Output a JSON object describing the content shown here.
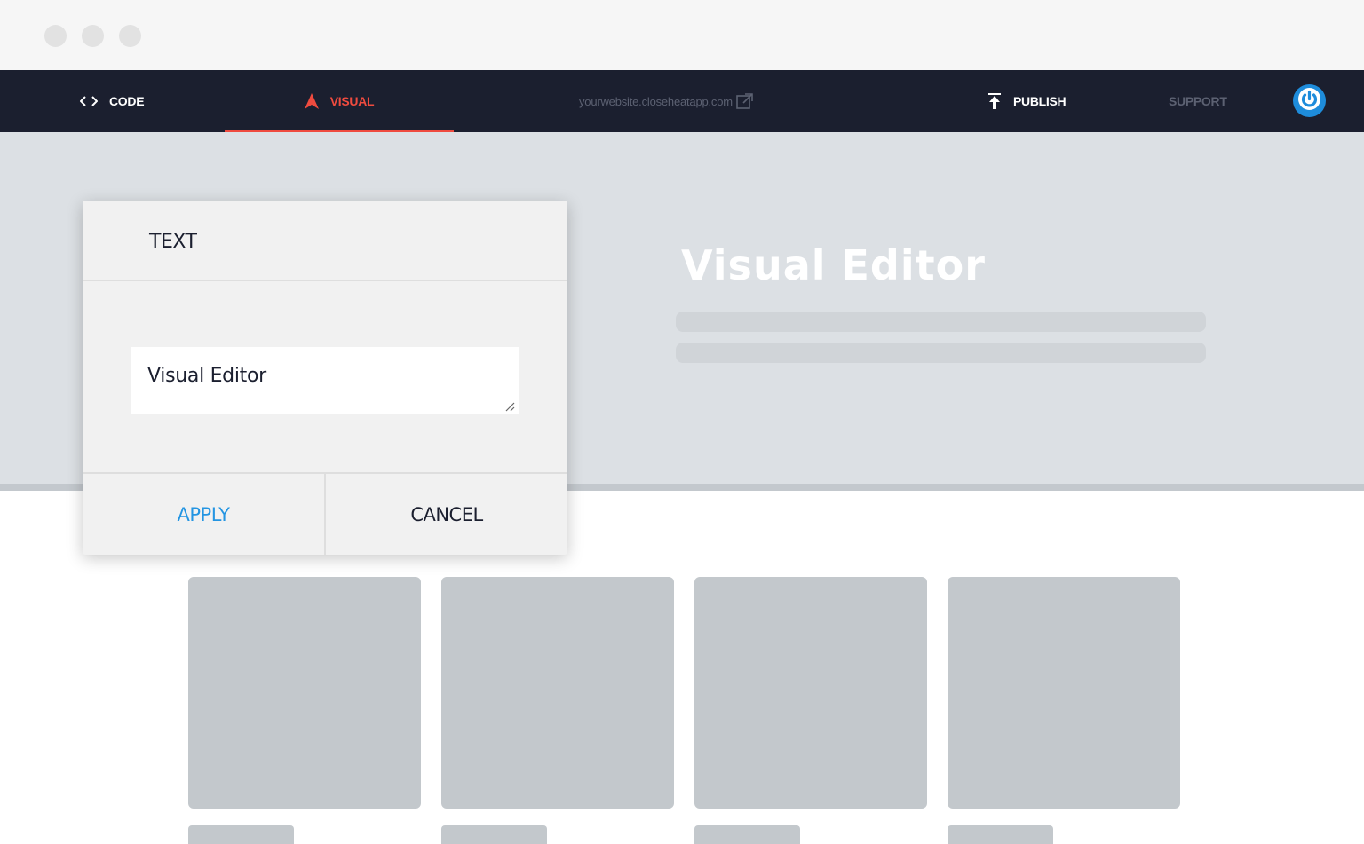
{
  "window": {
    "controls": [
      "window-dot",
      "window-dot",
      "window-dot"
    ]
  },
  "nav": {
    "code_label": "CODE",
    "visual_label": "VISUAL",
    "url_label": "yourwebsite.closeheatapp.com",
    "publish_label": "PUBLISH",
    "support_label": "SUPPORT",
    "icons": {
      "code": "code-brackets-icon",
      "visual": "arrow-cursor-icon",
      "url": "external-link-icon",
      "publish": "upload-icon",
      "power": "power-icon"
    },
    "colors": {
      "background": "#1b1f2f",
      "active": "#ef4b3f",
      "muted": "#5c6172",
      "power": "#1e8cdb"
    }
  },
  "hero": {
    "title": "Visual Editor"
  },
  "panel": {
    "title": "TEXT",
    "textarea_value": "Visual Editor",
    "apply_label": "APPLY",
    "cancel_label": "CANCEL",
    "colors": {
      "apply": "#2495e2"
    }
  }
}
